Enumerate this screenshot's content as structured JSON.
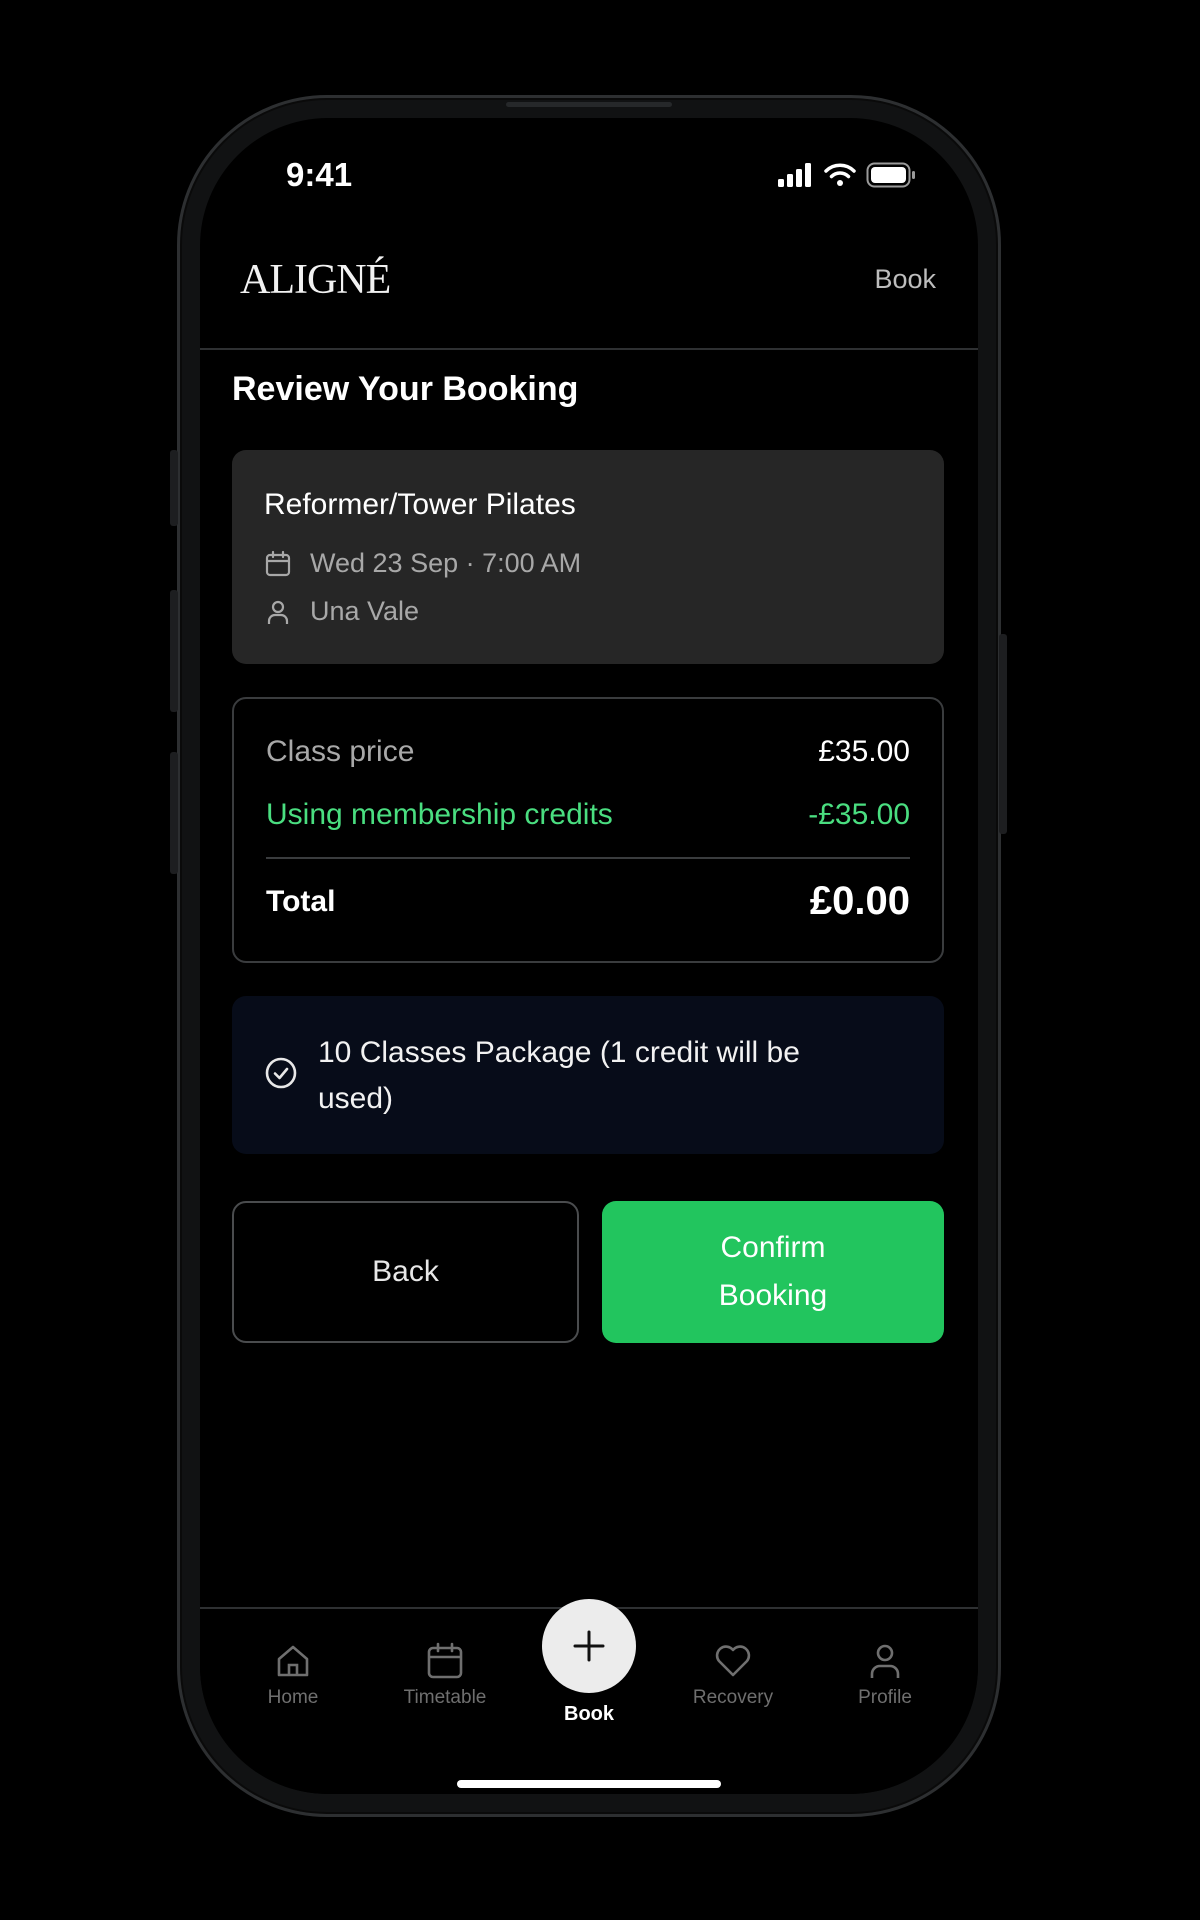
{
  "status_bar": {
    "time": "9:41"
  },
  "header": {
    "logo": "ALIGNÉ",
    "nav_link": "Book"
  },
  "page_title": "Review Your Booking",
  "class_card": {
    "name": "Reformer/Tower Pilates",
    "datetime": "Wed 23 Sep · 7:00 AM",
    "instructor": "Una Vale"
  },
  "pricing": {
    "class_price_label": "Class price",
    "class_price_value": "£35.00",
    "credits_label": "Using membership credits",
    "credits_value": "-£35.00",
    "total_label": "Total",
    "total_value": "£0.00"
  },
  "package": {
    "text": "10 Classes Package (1 credit will be used)"
  },
  "actions": {
    "back_label": "Back",
    "confirm_label": "Confirm Booking"
  },
  "tabbar": {
    "home": "Home",
    "timetable": "Timetable",
    "book": "Book",
    "recovery": "Recovery",
    "profile": "Profile"
  },
  "colors": {
    "accent_green": "#22c55e",
    "credit_green": "#4ade80",
    "package_bg": "#070c19",
    "card_bg": "#262626"
  }
}
